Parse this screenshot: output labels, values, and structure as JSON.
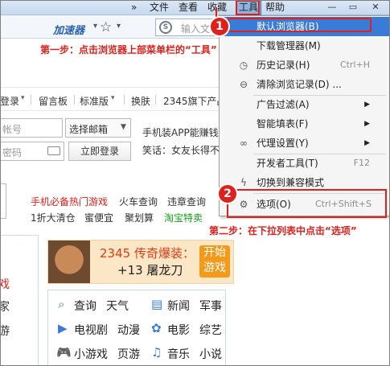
{
  "menubar": {
    "overflow": "»",
    "items": [
      "文件",
      "查看",
      "收藏",
      "工具",
      "帮助"
    ],
    "window_buttons": [
      "—",
      "▭",
      "✕"
    ]
  },
  "toolbar": {
    "accelerator": "加速器",
    "accelerator_caret": "▾",
    "search_logo": "S",
    "search_placeholder": "输入文"
  },
  "annotations": {
    "step1_num": "1",
    "step1_text": "第一步：点击浏览器上部菜单栏的“工具”",
    "step2_num": "2",
    "step2_text": "第二步：在下拉列表中点击“选项”"
  },
  "page": {
    "nav": [
      "登录",
      "留言板",
      "标准版",
      "换肤",
      "2345旗下产品"
    ],
    "nav_carets": [
      "▾",
      "▾"
    ],
    "account_placeholder": "帐号",
    "email_select": "选择邮箱",
    "password_placeholder": "密码",
    "login_button": "立即登录",
    "promo_line1": "手机装APP能赚钱",
    "promo_line2": "笑话：女友长得不",
    "links_row1": [
      "手机必备热门游戏",
      "火车查询",
      "违章查询"
    ],
    "links_row2": [
      "1折大清仓",
      "蜜便宜",
      "聚划算",
      "淘宝特卖"
    ],
    "left_fragments": [
      "戏",
      "家",
      "游"
    ],
    "banner": {
      "title": "2345 传奇爆装：",
      "subtitle": "+13 屠龙刀",
      "play": "开始游戏"
    },
    "grid": [
      [
        "查询",
        "天气",
        "新闻",
        "军事"
      ],
      [
        "电视剧",
        "动漫",
        "电影",
        "综艺"
      ],
      [
        "小游戏",
        "页游",
        "音乐",
        "小说"
      ]
    ]
  },
  "dropdown": {
    "items": [
      {
        "label": "默认浏览器(B)",
        "shortcut": "",
        "icon": "",
        "submenu": false
      },
      {
        "label": "下载管理器(M)",
        "shortcut": "",
        "icon": "",
        "submenu": false
      },
      {
        "label": "历史记录(H)",
        "shortcut": "Ctrl+H",
        "icon": "clock-icon",
        "submenu": false
      },
      {
        "label": "清除浏览记录(D) ...",
        "shortcut": "",
        "icon": "clear-icon",
        "submenu": false
      },
      {
        "label": "广告过滤(A)",
        "shortcut": "",
        "icon": "",
        "submenu": true
      },
      {
        "label": "智能填表(F)",
        "shortcut": "",
        "icon": "",
        "submenu": true
      },
      {
        "label": "代理设置(Y)",
        "shortcut": "",
        "icon": "link-icon",
        "submenu": true
      },
      {
        "label": "开发者工具(T)",
        "shortcut": "F12",
        "icon": "",
        "submenu": false
      },
      {
        "label": "切换到兼容模式",
        "shortcut": "",
        "icon": "bolt-icon",
        "submenu": false
      },
      {
        "label": "选项(O)",
        "shortcut": "Ctrl+Shift+S",
        "icon": "gear-icon",
        "submenu": false
      }
    ]
  },
  "colors": {
    "accent_red": "#e0201c",
    "highlight_blue": "#3b7bd8",
    "link_red": "#e0201c",
    "link_green": "#16a01a"
  }
}
